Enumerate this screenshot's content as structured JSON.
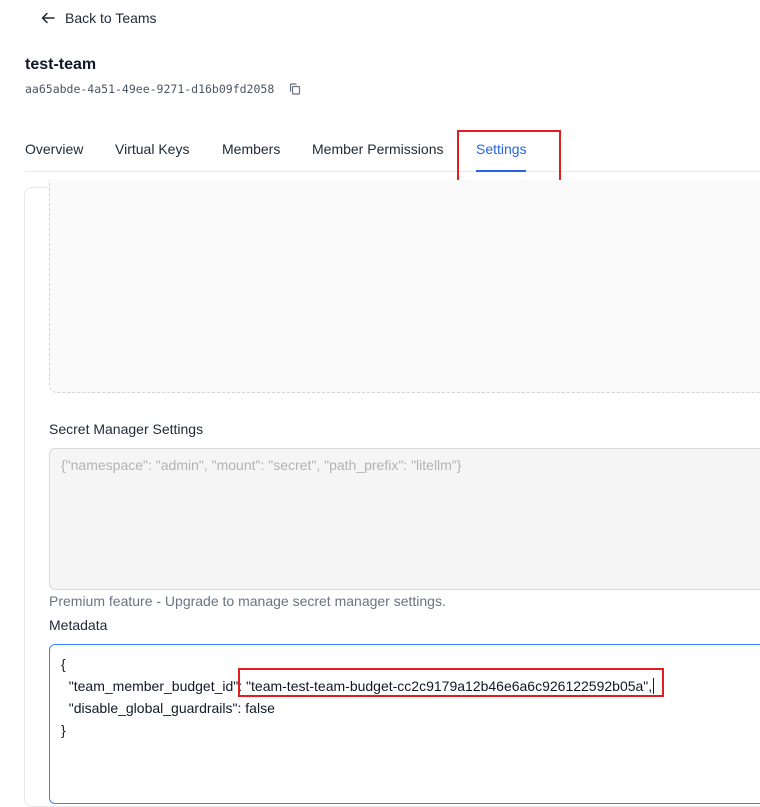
{
  "nav": {
    "back_label": "Back to Teams"
  },
  "team": {
    "name": "test-team",
    "id": "aa65abde-4a51-49ee-9271-d16b09fd2058"
  },
  "tabs": [
    {
      "label": "Overview"
    },
    {
      "label": "Virtual Keys"
    },
    {
      "label": "Members"
    },
    {
      "label": "Member Permissions"
    },
    {
      "label": "Settings",
      "active": true
    }
  ],
  "settings": {
    "secret_manager": {
      "label": "Secret Manager Settings",
      "placeholder": "{\"namespace\": \"admin\", \"mount\": \"secret\", \"path_prefix\": \"litellm\"}",
      "note": "Premium feature - Upgrade to manage secret manager settings."
    },
    "metadata": {
      "label": "Metadata",
      "line_open": "{",
      "line_key1": "  \"team_member_budget_id\": ",
      "line_val1": "\"team-test-team-budget-cc2c9179a12b46e6a6c926122592b05a\",",
      "line_2": "  \"disable_global_guardrails\": false",
      "line_close": "}"
    }
  },
  "colors": {
    "accent": "#2563eb",
    "highlight": "#e11d1d"
  }
}
